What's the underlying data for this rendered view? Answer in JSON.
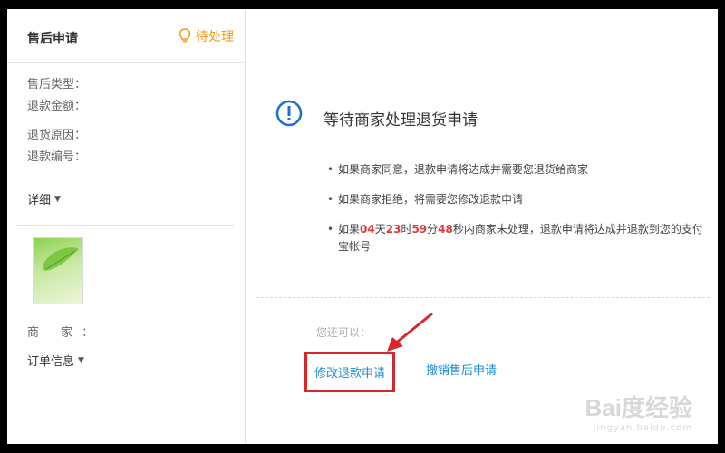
{
  "left": {
    "title": "售后申请",
    "status": "待处理",
    "fields": [
      "售后类型：",
      "退款金额：",
      "退货原因：",
      "退款编号："
    ],
    "detail_label": "详细",
    "merchant_label": "商 家：",
    "order_info_label": "订单信息"
  },
  "main": {
    "status_title": "等待商家处理退货申请",
    "bullets": {
      "b1": "如果商家同意，退款申请将达成并需要您退货给商家",
      "b2": "如果商家拒绝，将需要您修改退款申请",
      "b3_prefix": "如果",
      "b3_days": "04",
      "b3_days_unit": "天",
      "b3_hours": "23",
      "b3_hours_unit": "时",
      "b3_minutes": "59",
      "b3_minutes_unit": "分",
      "b3_seconds": "48",
      "b3_suffix": "秒内商家未处理，退款申请将达成并退款到您的支付宝帐号"
    },
    "you_can_label": "您还可以：",
    "actions": {
      "modify": "修改退款申请",
      "cancel": "撤销售后申请"
    }
  },
  "watermark": {
    "main": "Bai度经验",
    "sub": "jingyan.baidu.com"
  },
  "colors": {
    "pending": "#f39b16",
    "accent_link": "#1a8cd8",
    "countdown_red": "#e4393c",
    "highlight_box": "#d9262c",
    "status_icon": "#1a6fd8"
  },
  "icons": {
    "pending": "lightbulb-icon",
    "status": "exclamation-circle-icon",
    "dropdown": "chevron-down-icon"
  }
}
